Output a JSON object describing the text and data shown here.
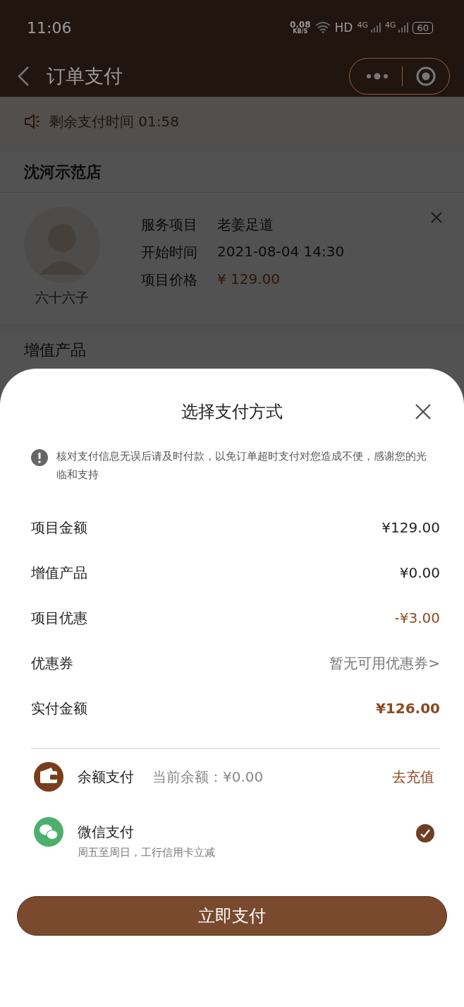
{
  "status_bar": {
    "time": "11:06",
    "speed": "0.08",
    "speed_unit": "KB/S",
    "hd": "HD",
    "net_1": "4G",
    "net_2": "4G",
    "battery": "60"
  },
  "nav": {
    "title": "订单支付"
  },
  "countdown": {
    "label": "剩余支付时间",
    "time": "01:58"
  },
  "store": {
    "name": "沈河示范店"
  },
  "order": {
    "staff_name": "六十六子",
    "fields": [
      {
        "label": "服务项目",
        "value": "老姜足道",
        "kind": "plain"
      },
      {
        "label": "开始时间",
        "value": "2021-08-04  14:30",
        "kind": "plain"
      },
      {
        "label": "项目价格",
        "value": "¥ 129.00",
        "kind": "price"
      }
    ]
  },
  "section_title": "增值产品",
  "sheet": {
    "title": "选择支付方式",
    "notice": "核对支付信息无误后请及时付款，以免订单超时支付对您造成不便，感谢您的光临和支持",
    "amounts": [
      {
        "label": "项目金额",
        "value": "¥129.00",
        "kind": "plain"
      },
      {
        "label": "增值产品",
        "value": "¥0.00",
        "kind": "plain"
      },
      {
        "label": "项目优惠",
        "value": "-¥3.00",
        "kind": "discount"
      },
      {
        "label": "优惠券",
        "value": "暂无可用优惠券>",
        "kind": "link"
      },
      {
        "label": "实付金额",
        "value": "¥126.00",
        "kind": "total"
      }
    ],
    "methods": [
      {
        "kind": "balance",
        "name": "余额支付",
        "detail": "当前余额：¥0.00",
        "action": "去充值",
        "selected": false
      },
      {
        "kind": "wechat",
        "name": "微信支付",
        "detail": "周五至周日，工行信用卡立减",
        "selected": true
      }
    ],
    "pay_button": "立即支付"
  }
}
